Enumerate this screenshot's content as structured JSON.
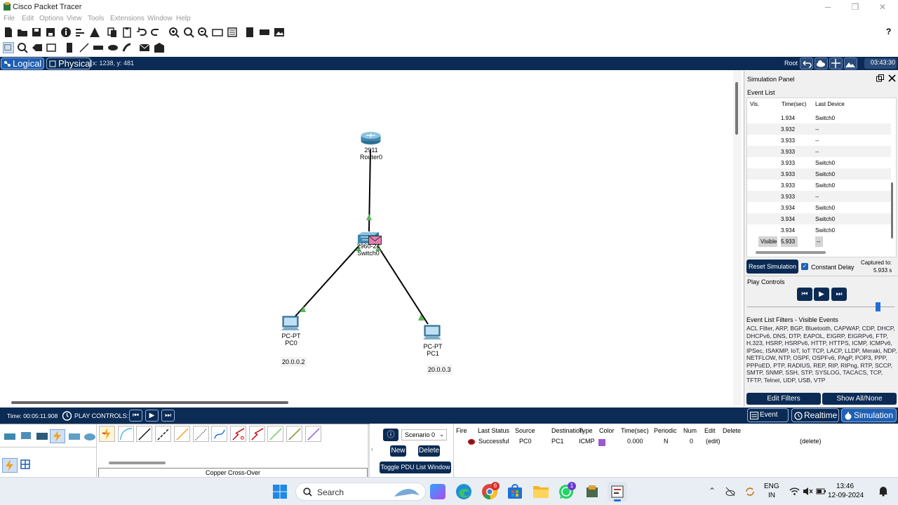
{
  "window": {
    "title": "Cisco Packet Tracer",
    "minimize": "─",
    "maximize": "❐",
    "close": "✕"
  },
  "menu": [
    "File",
    "Edit",
    "Options",
    "View",
    "Tools",
    "Extensions",
    "Window",
    "Help"
  ],
  "toolbar": {
    "help": "?"
  },
  "tabs": {
    "logical": "Logical",
    "physical": "Physical"
  },
  "coords": "x: 1238, y: 481",
  "topbar": {
    "root": "Root",
    "clock": "03:43:30"
  },
  "devices": {
    "router": {
      "model": "2911",
      "name": "Router0"
    },
    "switch": {
      "model": "2960-24",
      "name": "Switch0"
    },
    "pc0": {
      "model": "PC-PT",
      "name": "PC0",
      "ip": "20.0.0.2"
    },
    "pc1": {
      "model": "PC-PT",
      "name": "PC1",
      "ip": "20.0.0.3"
    }
  },
  "sim": {
    "title": "Simulation Panel",
    "event_list_label": "Event List",
    "columns": {
      "vis": "Vis.",
      "time": "Time(sec)",
      "device": "Last Device"
    },
    "rows": [
      {
        "vis": "",
        "time": "1.934",
        "device": "Switch0"
      },
      {
        "vis": "",
        "time": "3.932",
        "device": "--"
      },
      {
        "vis": "",
        "time": "3.933",
        "device": "--"
      },
      {
        "vis": "",
        "time": "3.933",
        "device": "--"
      },
      {
        "vis": "",
        "time": "3.933",
        "device": "Switch0"
      },
      {
        "vis": "",
        "time": "3.933",
        "device": "Switch0"
      },
      {
        "vis": "",
        "time": "3.933",
        "device": "Switch0"
      },
      {
        "vis": "",
        "time": "3.933",
        "device": "--"
      },
      {
        "vis": "",
        "time": "3.934",
        "device": "Switch0"
      },
      {
        "vis": "",
        "time": "3.934",
        "device": "Switch0"
      },
      {
        "vis": "",
        "time": "3.934",
        "device": "Switch0"
      },
      {
        "vis": "Visible",
        "time": "5.933",
        "device": "--"
      }
    ],
    "reset_label": "Reset Simulation",
    "constant_delay_label": "Constant Delay",
    "captured_label": "Captured to:",
    "captured_value": "5.933 s",
    "play_controls_label": "Play Controls",
    "filters_title": "Event List Filters - Visible Events",
    "filters_text": "ACL Filter, ARP, BGP, Bluetooth, CAPWAP, CDP, DHCP, DHCPv6, DNS, DTP, EAPOL, EIGRP, EIGRPv6, FTP, H.323, HSRP, HSRPv6, HTTP, HTTPS, ICMP, ICMPv6, IPSec, ISAKMP, IoT, IoT TCP, LACP, LLDP, Meraki, NDP, NETFLOW, NTP, OSPF, OSPFv6, PAgP, POP3, PPP, PPPoED, PTP, RADIUS, REP, RIP, RIPng, RTP, SCCP, SMTP, SNMP, SSH, STP, SYSLOG, TACACS, TCP, TFTP, Telnet, UDP, USB, VTP",
    "edit_filters": "Edit Filters",
    "show_all": "Show All/None"
  },
  "status": {
    "time": "Time: 00:05:11.908",
    "play_controls": "PLAY CONTROLS:",
    "event_list": "Event List",
    "realtime": "Realtime",
    "simulation": "Simulation"
  },
  "devpanel": {
    "selected_connection": "Copper Cross-Over"
  },
  "pdu": {
    "scenario": "Scenario 0",
    "new": "New",
    "delete": "Delete",
    "toggle": "Toggle PDU List Window",
    "headers": [
      "Fire",
      "Last Status",
      "Source",
      "Destination",
      "Type",
      "Color",
      "Time(sec)",
      "Periodic",
      "Num",
      "Edit",
      "Delete"
    ],
    "row": {
      "status": "Successful",
      "source": "PC0",
      "destination": "PC1",
      "type": "ICMP",
      "color": "#9b59d0",
      "time": "0.000",
      "periodic": "N",
      "num": "0",
      "edit": "(edit)",
      "delete": "(delete)"
    }
  },
  "taskbar": {
    "search": "Search",
    "lang1": "ENG",
    "lang2": "IN",
    "time": "13:46",
    "date": "12-09-2024",
    "badge_chrome": "6",
    "badge_whatsapp": "1"
  },
  "colors": {
    "accent": "#0b2b55",
    "highlight": "#1f5fb3",
    "link_up": "#5cb85c"
  }
}
